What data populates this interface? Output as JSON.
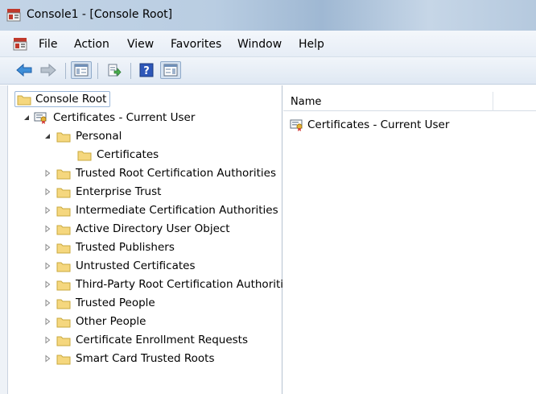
{
  "window": {
    "title": "Console1 - [Console Root]"
  },
  "menu": {
    "file": "File",
    "action": "Action",
    "view": "View",
    "favorites": "Favorites",
    "window": "Window",
    "help": "Help"
  },
  "tree": {
    "root": "Console Root",
    "cert_store": "Certificates - Current User",
    "personal": "Personal",
    "personal_certs": "Certificates",
    "items": [
      "Trusted Root Certification Authorities",
      "Enterprise Trust",
      "Intermediate Certification Authorities",
      "Active Directory User Object",
      "Trusted Publishers",
      "Untrusted Certificates",
      "Third-Party Root Certification Authorities",
      "Trusted People",
      "Other People",
      "Certificate Enrollment Requests",
      "Smart Card Trusted Roots"
    ]
  },
  "list": {
    "column_name": "Name",
    "rows": [
      "Certificates - Current User"
    ]
  },
  "colors": {
    "folder": "#f5d77e",
    "selection_border": "#9ab6d8",
    "toolbar_arrow": "#3f8fd8"
  }
}
